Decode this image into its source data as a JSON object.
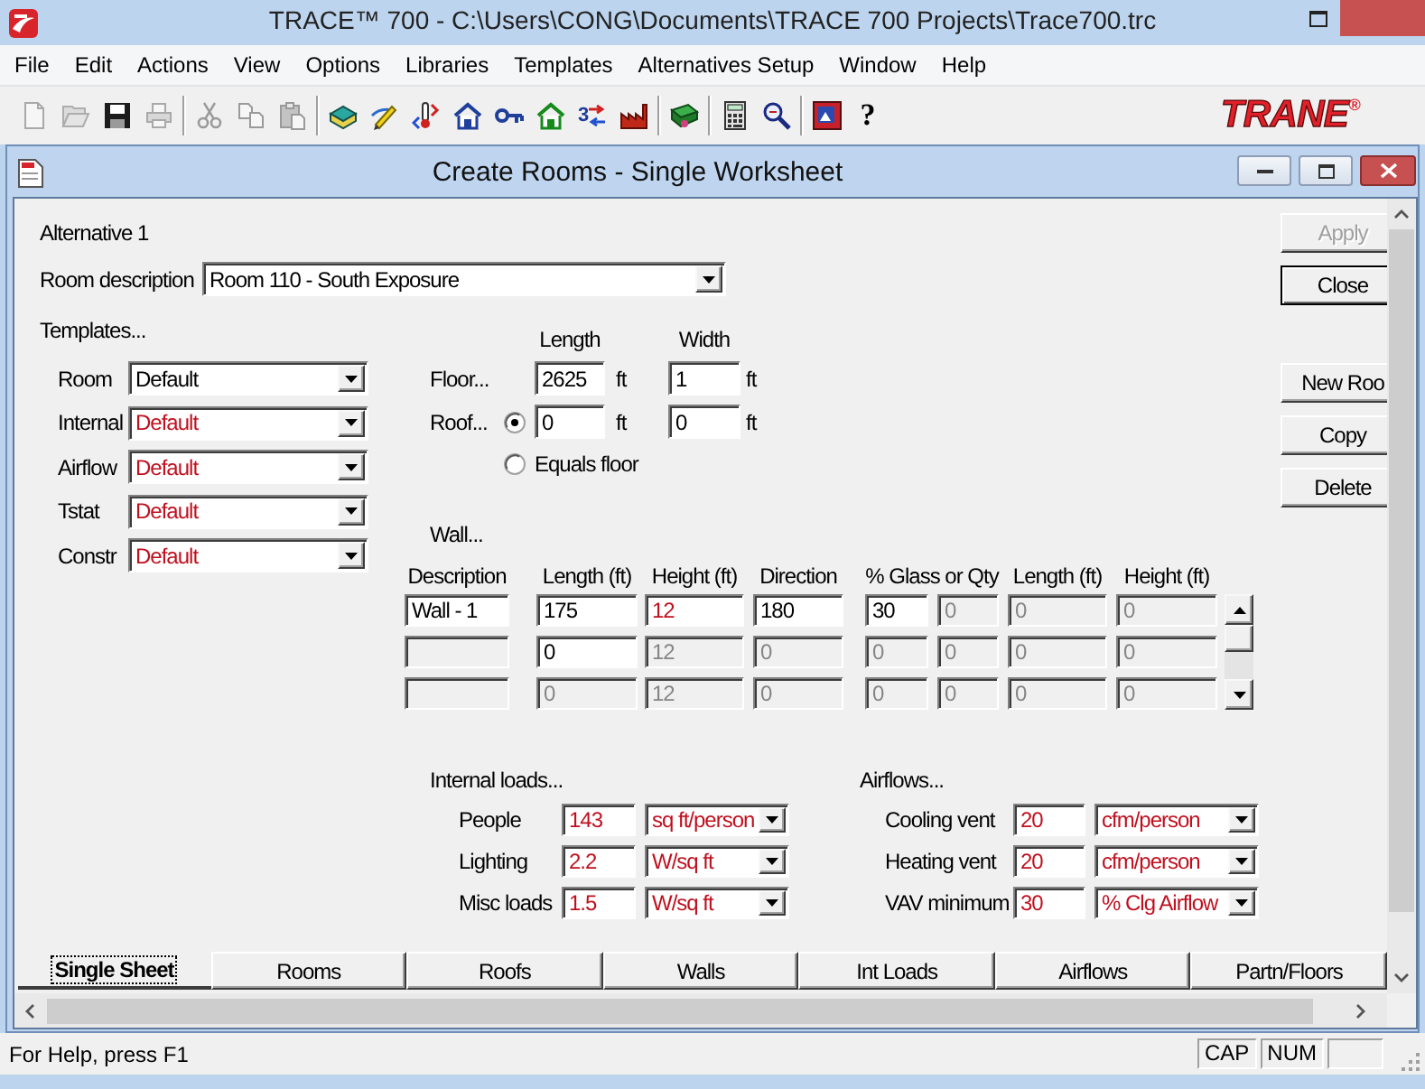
{
  "app_window": {
    "title": "TRACE™ 700 - C:\\Users\\CONG\\Documents\\TRACE 700 Projects\\Trace700.trc"
  },
  "menu": [
    "File",
    "Edit",
    "Actions",
    "View",
    "Options",
    "Libraries",
    "Templates",
    "Alternatives Setup",
    "Window",
    "Help"
  ],
  "toolbar": {
    "groups": [
      [
        {
          "kind": "new",
          "disabled": true
        },
        {
          "kind": "open",
          "disabled": true
        },
        {
          "kind": "save",
          "disabled": false
        },
        {
          "kind": "print",
          "disabled": true
        }
      ],
      [
        {
          "kind": "cut",
          "disabled": true
        },
        {
          "kind": "copy",
          "disabled": true
        },
        {
          "kind": "paste",
          "disabled": true
        }
      ],
      [
        {
          "kind": "stack",
          "disabled": false
        },
        {
          "kind": "pencil",
          "disabled": false
        },
        {
          "kind": "thermometer",
          "disabled": false
        },
        {
          "kind": "house",
          "color": "#1f3f9a",
          "disabled": false
        },
        {
          "kind": "key",
          "disabled": false
        },
        {
          "kind": "house",
          "color": "#178a1c",
          "disabled": false
        },
        {
          "kind": "numbered-arrows",
          "glyph": "3",
          "disabled": false
        },
        {
          "kind": "factory",
          "disabled": false
        }
      ],
      [
        {
          "kind": "machine",
          "disabled": false
        }
      ],
      [
        {
          "kind": "calculator",
          "disabled": false
        },
        {
          "kind": "magnifier",
          "disabled": false
        }
      ],
      [
        {
          "kind": "picture",
          "disabled": false
        },
        {
          "kind": "help",
          "glyph": "?",
          "disabled": false
        }
      ]
    ],
    "logo": "TRANE$^{®}$"
  },
  "document_window": {
    "title": "Create Rooms - Single Worksheet"
  },
  "form": {
    "alternative": "Alternative 1",
    "room_description": {
      "label": "Room description",
      "value": "Room 110 - South Exposure"
    },
    "templates": {
      "title": "Templates...",
      "rows": [
        {
          "label": "Room",
          "value": "Default",
          "from_template": false
        },
        {
          "label": "Internal",
          "value": "Default",
          "from_template": true
        },
        {
          "label": "Airflow",
          "value": "Default",
          "from_template": true
        },
        {
          "label": "Tstat",
          "value": "Default",
          "from_template": true
        },
        {
          "label": "Constr",
          "value": "Default",
          "from_template": true
        }
      ]
    },
    "dimensions": {
      "headers": [
        "Length",
        "Width"
      ],
      "rows": [
        {
          "kind": "floor",
          "label": "Floor...",
          "values": [
            {
              "value": "2625",
              "unit": "ft"
            },
            {
              "value": "1",
              "unit": "ft"
            }
          ]
        },
        {
          "kind": "roof",
          "label": "Roof...",
          "values": [
            {
              "value": "0",
              "unit": "ft"
            },
            {
              "value": "0",
              "unit": "ft"
            }
          ]
        }
      ],
      "roof_options": [
        {
          "kind": "custom",
          "selected": true
        },
        {
          "kind": "equals-floor",
          "label": "Equals floor",
          "selected": false
        }
      ]
    },
    "walls": {
      "title": "Wall...",
      "columns": [
        {
          "label": "Description",
          "kind": "single"
        },
        {
          "label": "Length (ft)",
          "kind": "single"
        },
        {
          "label": "Height (ft)",
          "kind": "single"
        },
        {
          "label": "Direction",
          "kind": "single"
        },
        {
          "label": "% Glass or Qty",
          "kind": "pair"
        },
        {
          "label": "Length (ft)",
          "kind": "single"
        },
        {
          "label": "Height (ft)",
          "kind": "single"
        }
      ],
      "rows": [
        [
          {
            "value": "Wall - 1",
            "disabled": false,
            "from_template": false
          },
          {
            "value": "175",
            "disabled": false,
            "from_template": false
          },
          {
            "value": "12",
            "disabled": false,
            "from_template": true
          },
          {
            "value": "180",
            "disabled": false,
            "from_template": false
          },
          {
            "parts": [
              {
                "value": "30",
                "disabled": false,
                "from_template": false
              },
              {
                "value": "0",
                "disabled": true,
                "from_template": false
              }
            ]
          },
          {
            "value": "0",
            "disabled": true,
            "from_template": false
          },
          {
            "value": "0",
            "disabled": true,
            "from_template": false
          }
        ],
        [
          {
            "disabled": true,
            "from_template": false
          },
          {
            "value": "0",
            "disabled": false,
            "from_template": false
          },
          {
            "value": "12",
            "disabled": true,
            "from_template": false
          },
          {
            "value": "0",
            "disabled": true,
            "from_template": false
          },
          {
            "parts": [
              {
                "value": "0",
                "disabled": true,
                "from_template": false
              },
              {
                "value": "0",
                "disabled": true,
                "from_template": false
              }
            ]
          },
          {
            "value": "0",
            "disabled": true,
            "from_template": false
          },
          {
            "value": "0",
            "disabled": true,
            "from_template": false
          }
        ],
        [
          {
            "disabled": true,
            "from_template": false
          },
          {
            "value": "0",
            "disabled": true,
            "from_template": false
          },
          {
            "value": "12",
            "disabled": true,
            "from_template": false
          },
          {
            "value": "0",
            "disabled": true,
            "from_template": false
          },
          {
            "parts": [
              {
                "value": "0",
                "disabled": true,
                "from_template": false
              },
              {
                "value": "0",
                "disabled": true,
                "from_template": false
              }
            ]
          },
          {
            "value": "0",
            "disabled": true,
            "from_template": false
          },
          {
            "value": "0",
            "disabled": true,
            "from_template": false
          }
        ]
      ]
    },
    "internal_loads": {
      "title": "Internal loads...",
      "rows": [
        {
          "label": "People",
          "value": "143",
          "unit": "sq ft/person",
          "from_template": true
        },
        {
          "label": "Lighting",
          "value": "2.2",
          "unit": "W/sq ft",
          "from_template": true
        },
        {
          "label": "Misc loads",
          "value": "1.5",
          "unit": "W/sq ft",
          "from_template": true
        }
      ]
    },
    "airflows": {
      "title": "Airflows...",
      "rows": [
        {
          "label": "Cooling vent",
          "value": "20",
          "unit": "cfm/person",
          "from_template": true
        },
        {
          "label": "Heating vent",
          "value": "20",
          "unit": "cfm/person",
          "from_template": true
        },
        {
          "label": "VAV minimum",
          "value": "30",
          "unit": "% Clg Airflow",
          "from_template": true
        }
      ]
    }
  },
  "buttons": [
    [
      {
        "label": "Apply",
        "disabled": true,
        "default": false
      },
      {
        "label": "Close",
        "disabled": false,
        "default": true
      }
    ],
    [
      {
        "label": "New Roo",
        "disabled": false,
        "default": false
      },
      {
        "label": "Copy",
        "disabled": false,
        "default": false
      },
      {
        "label": "Delete",
        "disabled": false,
        "default": false
      }
    ]
  ],
  "tabs": [
    {
      "label": "Single Sheet",
      "selected": true
    },
    {
      "label": "Rooms",
      "selected": false
    },
    {
      "label": "Roofs",
      "selected": false
    },
    {
      "label": "Walls",
      "selected": false
    },
    {
      "label": "Int Loads",
      "selected": false
    },
    {
      "label": "Airflows",
      "selected": false
    },
    {
      "label": "Partn/Floors",
      "selected": false
    }
  ],
  "status_bar": {
    "text": "For Help, press F1",
    "indicators": [
      "CAP",
      "NUM"
    ]
  }
}
